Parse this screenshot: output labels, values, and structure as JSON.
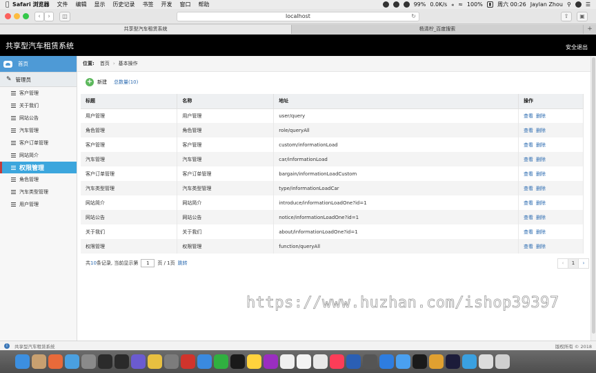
{
  "menubar": {
    "app_name": "Safari 浏览器",
    "items": [
      "文件",
      "编辑",
      "显示",
      "历史记录",
      "书签",
      "开发",
      "窗口",
      "帮助"
    ],
    "status": {
      "battery_text": "99%",
      "net_speed": "0.0K/s",
      "battery2": "100%",
      "datetime": "周六 00:26",
      "user": "Jaylan Zhou"
    }
  },
  "browser": {
    "address": "localhost",
    "tabs": [
      {
        "label": "共享型汽车租赁系统",
        "active": true
      },
      {
        "label": "杨清柠_百度搜索",
        "active": false
      }
    ]
  },
  "header": {
    "title": "共享型汽车租赁系统",
    "logout": "安全退出"
  },
  "sidebar": {
    "home": "首页",
    "group": "管理员",
    "items": [
      "客户管理",
      "关于我们",
      "网站公告",
      "汽车管理",
      "客户订单管理",
      "网站简介"
    ],
    "section": "权限管理",
    "sub_items": [
      "角色管理",
      "汽车类型管理",
      "用户管理"
    ]
  },
  "breadcrumb": {
    "label": "位置:",
    "home": "首页",
    "current": "基本操作"
  },
  "actions": {
    "new_label": "新建",
    "count_label": "总数量(10)"
  },
  "table": {
    "headers": [
      "标题",
      "名称",
      "地址",
      "操作"
    ],
    "view_label": "查看",
    "delete_label": "删除",
    "rows": [
      {
        "title": "用户管理",
        "name": "用户管理",
        "url": "user/query"
      },
      {
        "title": "角色管理",
        "name": "角色管理",
        "url": "role/queryAll"
      },
      {
        "title": "客户管理",
        "name": "客户管理",
        "url": "custom/informationLoad"
      },
      {
        "title": "汽车管理",
        "name": "汽车管理",
        "url": "car/informationLoad"
      },
      {
        "title": "客户订单管理",
        "name": "客户订单管理",
        "url": "bargain/informationLoadCustom"
      },
      {
        "title": "汽车类型管理",
        "name": "汽车类型管理",
        "url": "type/informationLoadCar"
      },
      {
        "title": "网站简介",
        "name": "网站简介",
        "url": "introduce/informationLoadOne?id=1"
      },
      {
        "title": "网站公告",
        "name": "网站公告",
        "url": "notice/informationLoadOne?id=1"
      },
      {
        "title": "关于我们",
        "name": "关于我们",
        "url": "about/informationLoadOne?id=1"
      },
      {
        "title": "权限管理",
        "name": "权限管理",
        "url": "function/queryAll"
      }
    ]
  },
  "pagination": {
    "prefix": "共",
    "total": "10",
    "mid": "条记录,  当前显示第",
    "page": "1",
    "suffix": "页 / 1页",
    "jump": "跳转",
    "current_page": "1",
    "prev": "‹",
    "next": "›"
  },
  "watermark": "https://www.huzhan.com/ishop39397",
  "statusbar": {
    "left": "共享型汽车租赁系统",
    "right": "版权所有 © 2018"
  },
  "dock": {
    "colors": [
      "#3c8fe0",
      "#c8a070",
      "#e86a3a",
      "#4aa0e0",
      "#8a8a8a",
      "#2b2b2b",
      "#2a2a2a",
      "#6b5bd0",
      "#e8c040",
      "#7c7c7c",
      "#d0342c",
      "#3a8ae0",
      "#30b040",
      "#1a1a1a",
      "#ffd33d",
      "#9a2ec0",
      "#f0f0f0",
      "#f4f4f4",
      "#e8e8e8",
      "#fc3d58",
      "#2b5fb4",
      "#555555",
      "#2e7de0",
      "#4aa0f0",
      "#1a1a1a",
      "#e0a030",
      "#1c1c3a",
      "#3aa0e0",
      "#dcdcdc",
      "#cfcfcf"
    ]
  }
}
